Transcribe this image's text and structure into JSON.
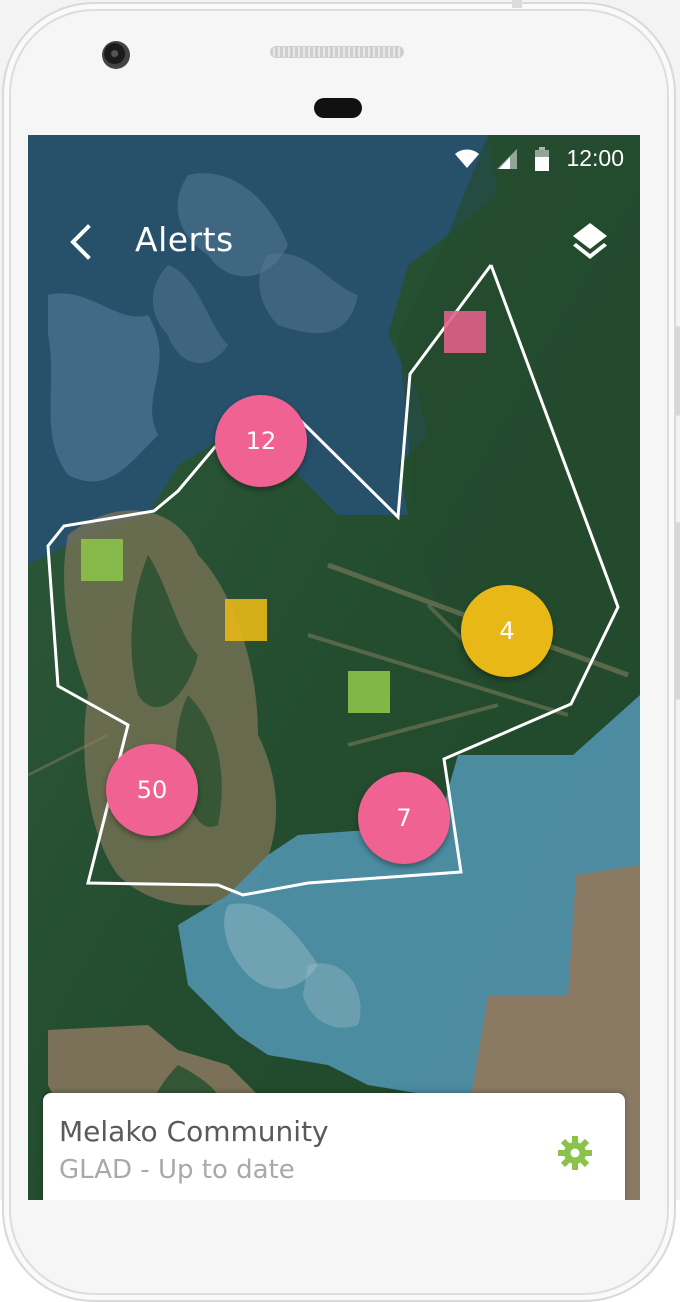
{
  "status_bar": {
    "time": "12:00",
    "icons": [
      "wifi-icon",
      "signal-icon",
      "battery-icon"
    ]
  },
  "app_bar": {
    "title": "Alerts",
    "back_icon": "chevron-left-icon",
    "layers_icon": "layers-icon"
  },
  "clusters": [
    {
      "label": "12",
      "color": "#f06292"
    },
    {
      "label": "4",
      "color": "#e8b817"
    },
    {
      "label": "50",
      "color": "#f06292"
    },
    {
      "label": "7",
      "color": "#f06292"
    }
  ],
  "markers": [
    {
      "color": "#e0618a"
    },
    {
      "color": "#8bc34a"
    },
    {
      "color": "#e8b817"
    },
    {
      "color": "#8bc34a"
    }
  ],
  "area_card": {
    "name": "Melako Community",
    "status": "GLAD - Up to date",
    "settings_icon": "gear-icon"
  },
  "colors": {
    "alert_pink": "#f06292",
    "alert_yellow": "#e8b817",
    "accent_green": "#8bc34a"
  }
}
